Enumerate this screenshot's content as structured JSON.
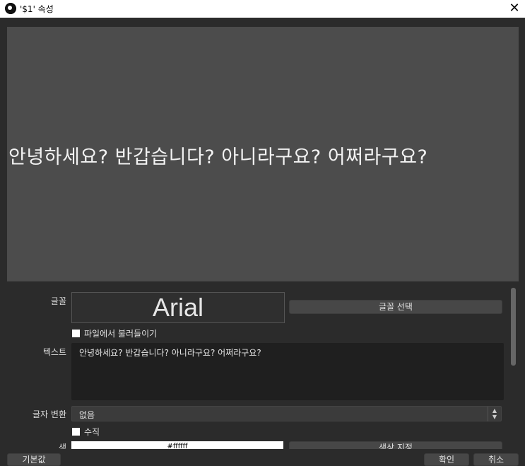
{
  "window": {
    "title": "'$1' 속성",
    "close_glyph": "✕"
  },
  "preview": {
    "text": "안녕하세요? 반갑습니다? 아니라구요? 어쩌라구요?"
  },
  "properties": {
    "font": {
      "label": "글꼴",
      "value": "Arial",
      "select_button": "글꼴 선택"
    },
    "from_file": {
      "label": "파일에서 불러들이기",
      "checked": false
    },
    "text": {
      "label": "텍스트",
      "value": "안녕하세요? 반갑습니다? 아니라구요? 어쩌라구요?"
    },
    "transform": {
      "label": "글자 변환",
      "value": "없음"
    },
    "vertical": {
      "label": "수직",
      "checked": false
    },
    "color": {
      "label": "색",
      "value": "#ffffff",
      "button": "색상 지정"
    }
  },
  "footer": {
    "defaults_button": "기본값",
    "ok_button": "확인",
    "cancel_button": "취소"
  },
  "colors": {
    "preview_bg": "#4c4c4c",
    "dialog_bg": "#2b2b2b",
    "textarea_bg": "#1f1f1f"
  }
}
